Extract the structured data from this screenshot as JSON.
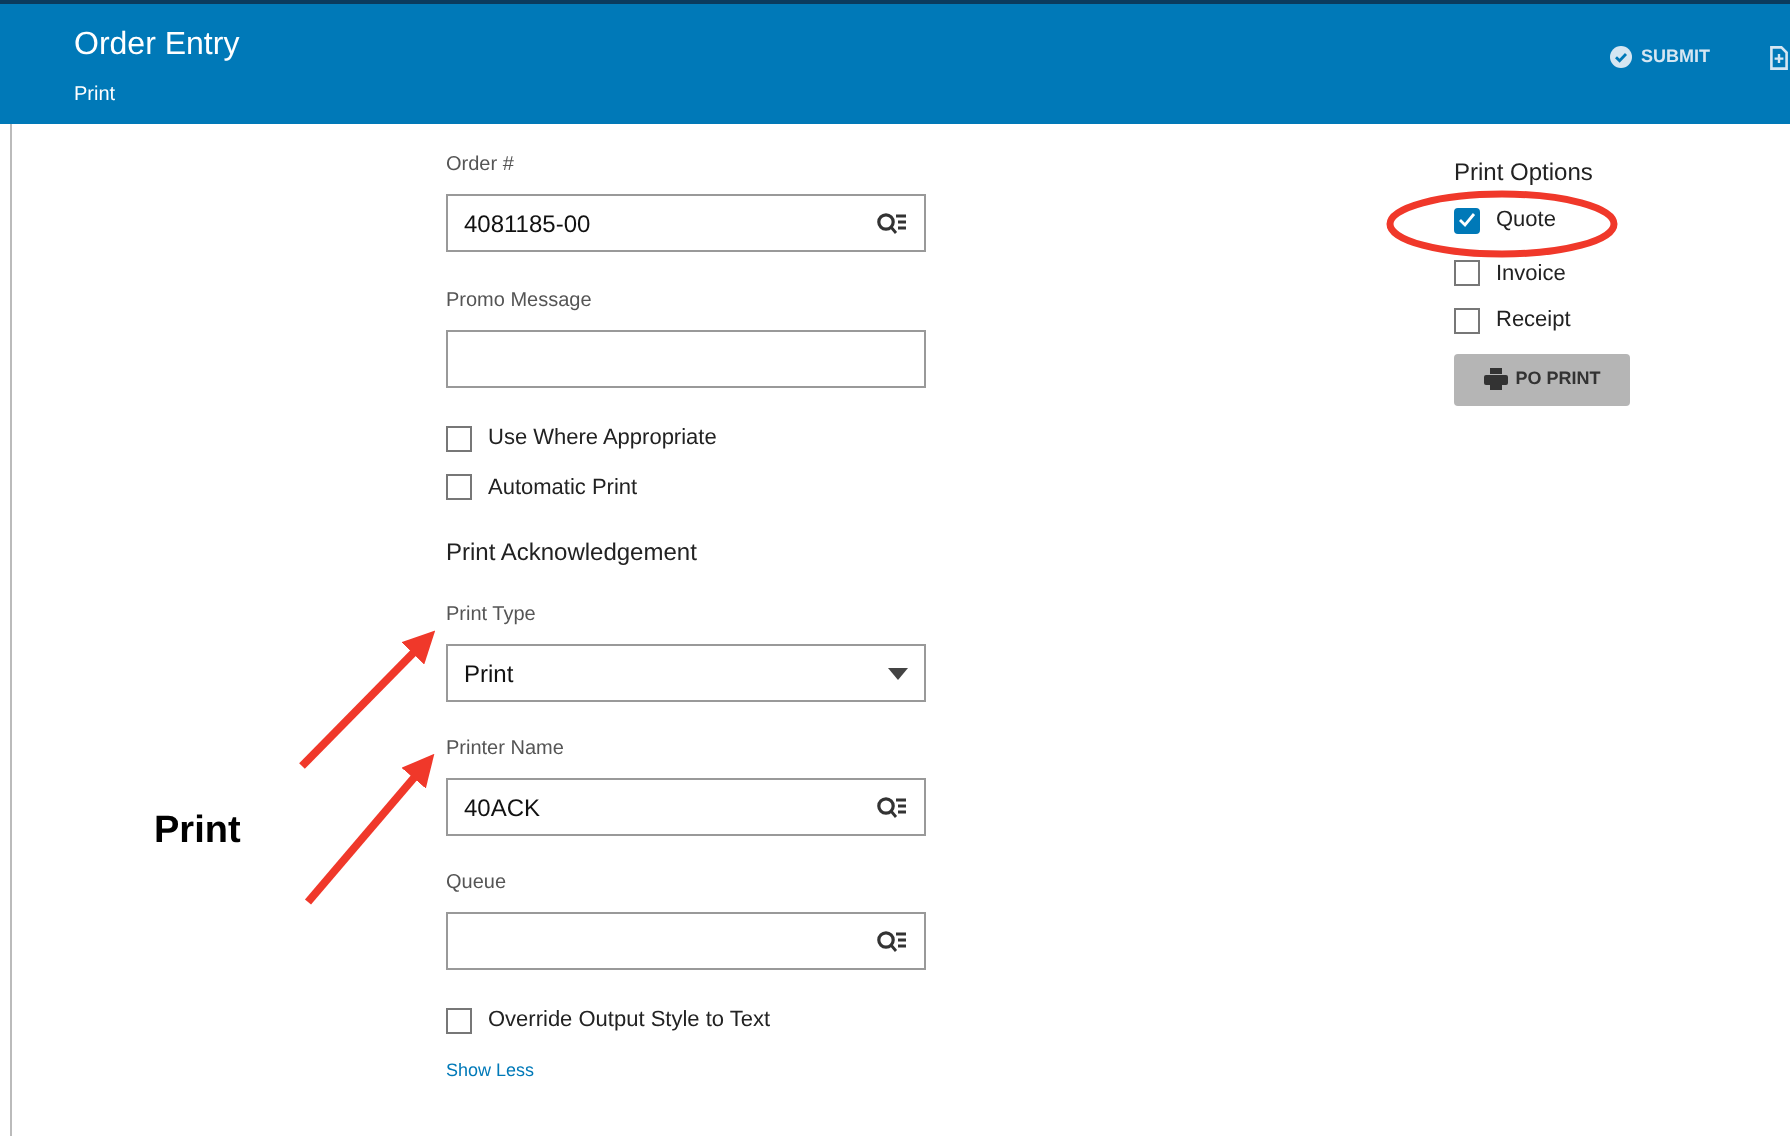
{
  "header": {
    "title": "Order Entry",
    "subtitle": "Print",
    "actions": [
      {
        "label": "SUBMIT",
        "kind": "submit"
      },
      {
        "kind": "document"
      }
    ]
  },
  "form": {
    "fields": [
      {
        "label": "Order #",
        "value": "4081185-00",
        "kind": "lookup"
      },
      {
        "label": "Promo Message",
        "kind": "text"
      }
    ],
    "options": [
      {
        "label": "Use Where Appropriate",
        "checked": false
      },
      {
        "label": "Automatic Print",
        "checked": false
      }
    ],
    "section_title": "Print Acknowledgement",
    "print_fields": [
      {
        "label": "Print Type",
        "value": "Print",
        "kind": "select"
      },
      {
        "label": "Printer Name",
        "value": "40ACK",
        "kind": "lookup"
      },
      {
        "label": "Queue",
        "kind": "lookup"
      }
    ],
    "override": {
      "label": "Override Output Style to Text",
      "checked": false
    },
    "toggle_link": "Show Less"
  },
  "print_options": {
    "title": "Print Options",
    "items": [
      {
        "label": "Quote",
        "checked": true
      },
      {
        "label": "Invoice",
        "checked": false
      },
      {
        "label": "Receipt",
        "checked": false
      }
    ],
    "button": "PO PRINT"
  },
  "annotation": {
    "label": "Print"
  }
}
